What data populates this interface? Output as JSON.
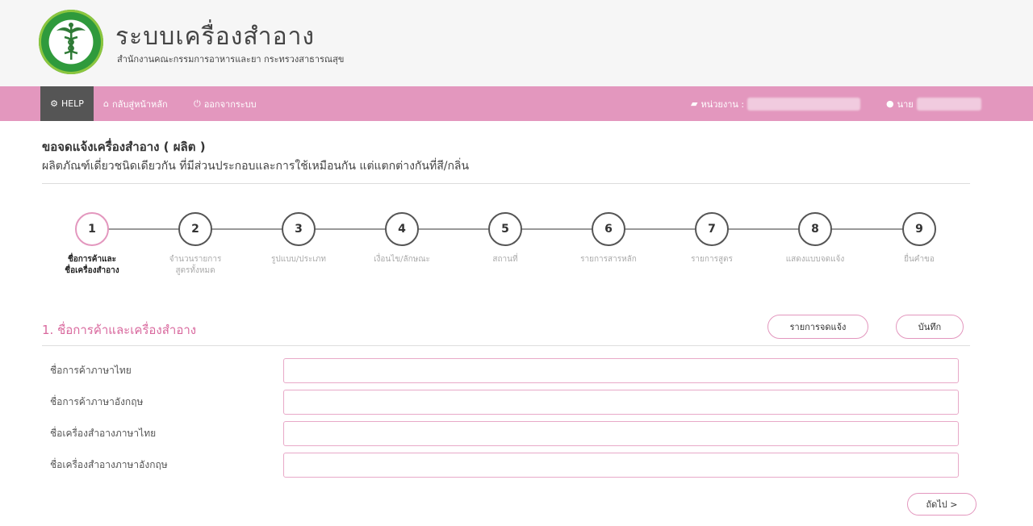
{
  "header": {
    "title": "ระบบเครื่องสำอาง",
    "subtitle": "สำนักงานคณะกรรมการอาหารและยา กระทรวงสาธารณสุข"
  },
  "nav": {
    "help": "HELP",
    "home": "กลับสู่หน้าหลัก",
    "logout": "ออกจากระบบ",
    "agency_label": "หน่วยงาน :",
    "user_prefix": "นาย"
  },
  "page": {
    "title": "ขอจดแจ้งเครื่องสำอาง ( ผลิต )",
    "subtitle": "ผลิตภัณฑ์เดี่ยวชนิดเดียวกัน ที่มีส่วนประกอบและการใช้เหมือนกัน แต่แตกต่างกันที่สี/กลิ่น"
  },
  "steps": [
    {
      "num": "1",
      "label": "ชื่อการค้าและ ชื่อเครื่องสำอาง"
    },
    {
      "num": "2",
      "label": "จำนวนรายการ สูตรทั้งหมด"
    },
    {
      "num": "3",
      "label": "รูปแบบ/ประเภท"
    },
    {
      "num": "4",
      "label": "เงื่อนไข/ลักษณะ"
    },
    {
      "num": "5",
      "label": "สถานที่"
    },
    {
      "num": "6",
      "label": "รายการสารหลัก"
    },
    {
      "num": "7",
      "label": "รายการสูตร"
    },
    {
      "num": "8",
      "label": "แสดงแบบจดแจ้ง"
    },
    {
      "num": "9",
      "label": "ยื่นคำขอ"
    }
  ],
  "section": {
    "title": "1. ชื่อการค้าและเครื่องสำอาง",
    "list_button": "รายการจดแจ้ง",
    "save_button": "บันทึก",
    "next_button": "ถัดไป >"
  },
  "fields": [
    {
      "label": "ชื่อการค้าภาษาไทย",
      "value": ""
    },
    {
      "label": "ชื่อการค้าภาษาอังกฤษ",
      "value": ""
    },
    {
      "label": "ชื่อเครื่องสำอางภาษาไทย",
      "value": ""
    },
    {
      "label": "ชื่อเครื่องสำอางภาษาอังกฤษ",
      "value": ""
    }
  ],
  "colors": {
    "navbar": "#e397be",
    "accent": "#d9699e",
    "help_bg": "#555555"
  }
}
